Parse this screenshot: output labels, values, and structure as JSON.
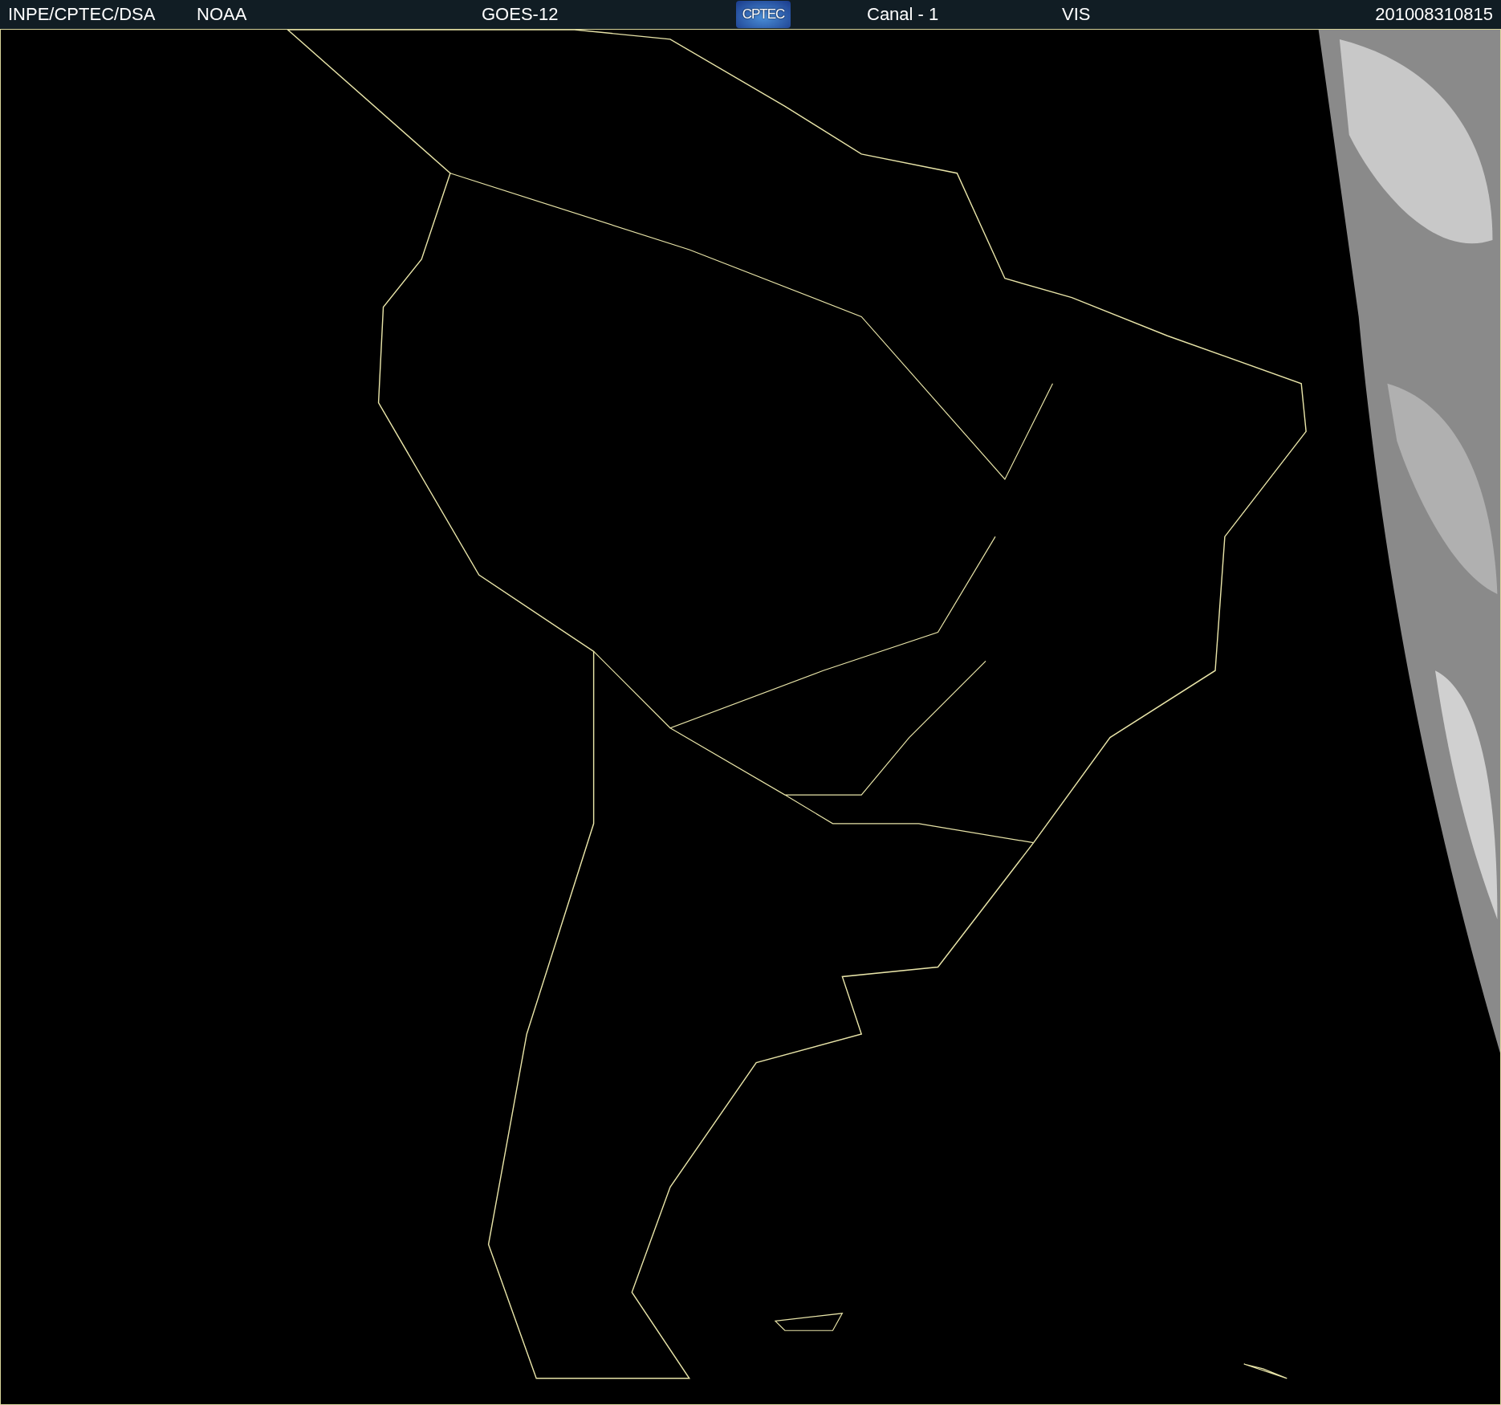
{
  "header": {
    "agency": "INPE/CPTEC/DSA",
    "source": "NOAA",
    "satellite": "GOES-12",
    "logo": "CPTEC",
    "channel": "Canal - 1",
    "band": "VIS",
    "timestamp": "201008310815"
  }
}
